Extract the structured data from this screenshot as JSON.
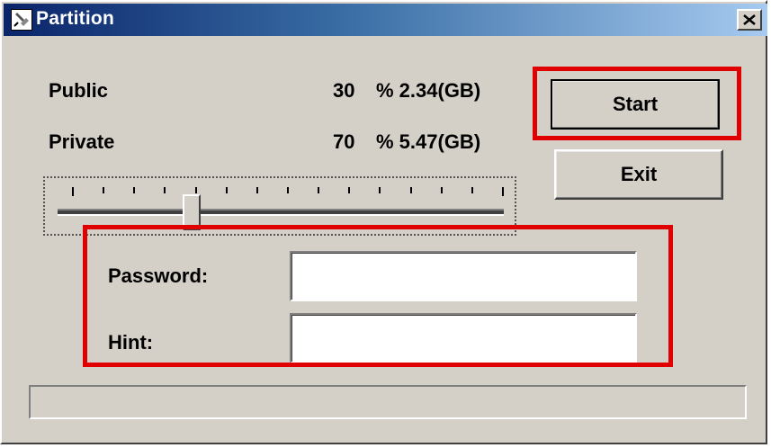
{
  "window": {
    "title": "Partition"
  },
  "public": {
    "label": "Public",
    "percent": "30",
    "size": "% 2.34(GB)"
  },
  "private": {
    "label": "Private",
    "percent": "70",
    "size": "% 5.47(GB)"
  },
  "slider": {
    "value_percent": 30
  },
  "buttons": {
    "start": "Start",
    "exit": "Exit"
  },
  "fields": {
    "password_label": "Password:",
    "password_value": "",
    "hint_label": "Hint:",
    "hint_value": ""
  },
  "status_bar": {
    "text": ""
  },
  "colors": {
    "highlight": "#e00000",
    "face": "#d4d0c8",
    "title_start": "#0a246a",
    "title_end": "#a6caf0"
  },
  "icons": {
    "app": "partition-tool-icon",
    "close": "close-icon"
  }
}
